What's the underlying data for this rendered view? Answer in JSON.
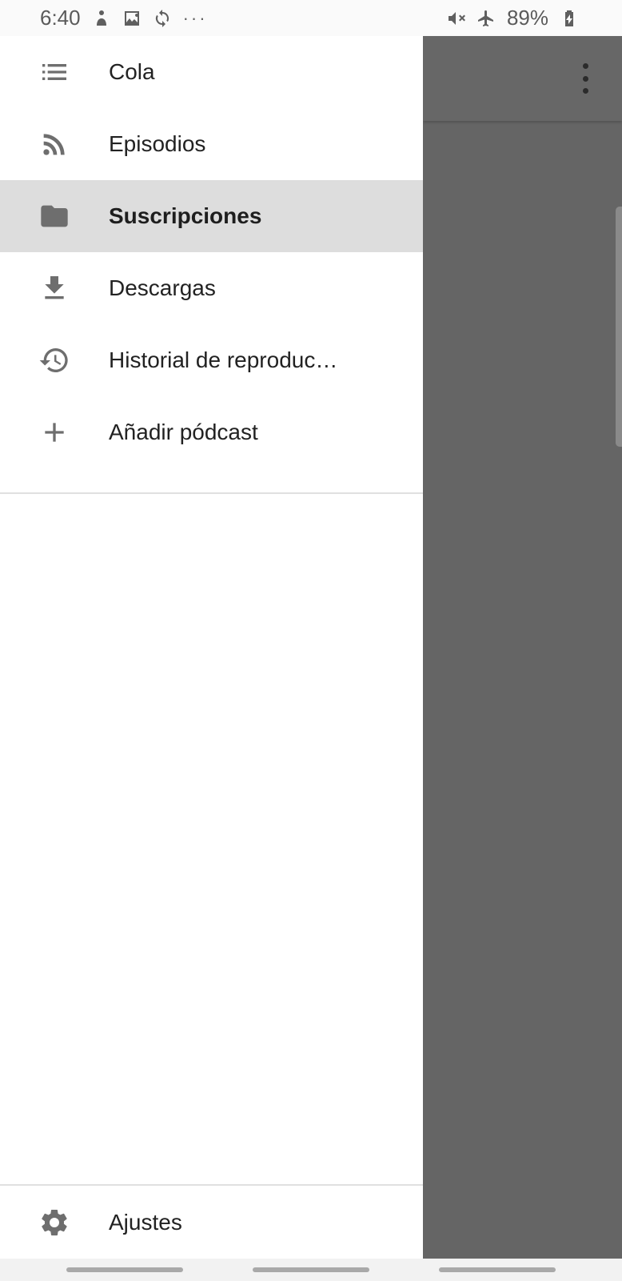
{
  "status_bar": {
    "time": "6:40",
    "left_icons": [
      "download-person-icon",
      "image-icon",
      "sync-icon"
    ],
    "more_indicator": "···",
    "right_icons": [
      "mute-vibrate-icon",
      "airplane-icon"
    ],
    "battery_percent": "89%",
    "battery_icon": "battery-charging-icon"
  },
  "drawer": {
    "items": [
      {
        "label": "Cola",
        "icon": "queue-list-icon",
        "selected": false
      },
      {
        "label": "Episodios",
        "icon": "rss-feed-icon",
        "selected": false
      },
      {
        "label": "Suscripciones",
        "icon": "folder-icon",
        "selected": true
      },
      {
        "label": "Descargas",
        "icon": "download-icon",
        "selected": false
      },
      {
        "label": "Historial de reproduc…",
        "icon": "history-icon",
        "selected": false
      },
      {
        "label": "Añadir pódcast",
        "icon": "add-icon",
        "selected": false
      }
    ],
    "footer": {
      "label": "Ajustes",
      "icon": "gear-icon"
    }
  },
  "colors": {
    "drawer_bg": "#ffffff",
    "selected_bg": "#dddddd",
    "scrim": "#656565",
    "icon": "#6e6e6e"
  }
}
